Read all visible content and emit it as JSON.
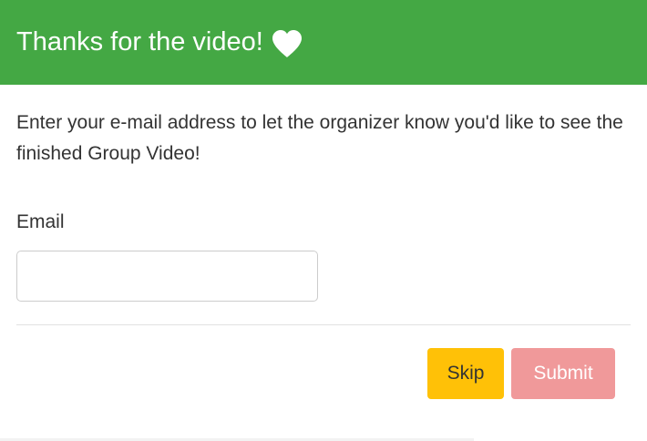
{
  "header": {
    "title": "Thanks for the video!",
    "icon": "heart-icon",
    "background_color": "#44a844"
  },
  "body": {
    "intro": "Enter your e-mail address to let the organizer know you'd like to see the finished Group Video!"
  },
  "form": {
    "email_label": "Email",
    "email_value": "",
    "email_placeholder": ""
  },
  "footer": {
    "skip_label": "Skip",
    "submit_label": "Submit",
    "skip_color": "#ffc107",
    "submit_color": "#f0999a"
  }
}
